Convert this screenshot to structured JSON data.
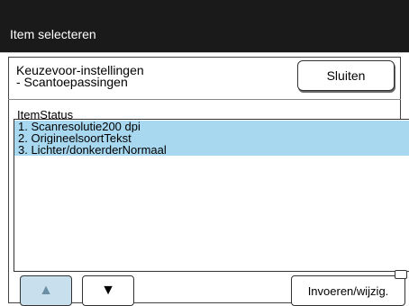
{
  "window": {
    "title": "Item selecteren"
  },
  "header": {
    "subtitle_line1": "Keuzevoor-instellingen",
    "subtitle_line2": "- Scantoepassingen",
    "close_label": "Sluiten"
  },
  "list": {
    "column_header": "ItemStatus",
    "items": [
      {
        "label": "1. Scanresolutie200 dpi"
      },
      {
        "label": "2. OrigineelsoortTekst"
      },
      {
        "label": "3. Lichter/donkerderNormaal"
      }
    ],
    "highlight_color": "#a8d8f0"
  },
  "footer": {
    "up_icon": "▲",
    "down_icon": "▼",
    "edit_label": "Invoeren/wijzig."
  }
}
